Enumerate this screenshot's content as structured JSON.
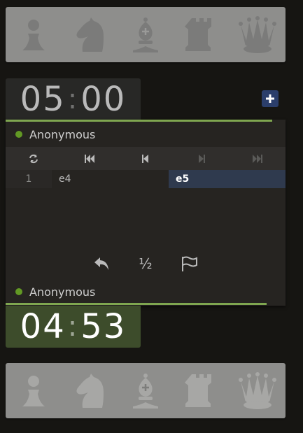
{
  "clocks": {
    "opponent": {
      "minutes": "05",
      "seconds": "00"
    },
    "player": {
      "minutes": "04",
      "seconds": "53"
    }
  },
  "players": {
    "top": {
      "name": "Anonymous"
    },
    "bottom": {
      "name": "Anonymous"
    }
  },
  "moves": [
    {
      "number": "1",
      "white": "e4",
      "black": "e5"
    }
  ],
  "actions": {
    "draw_label": "½"
  },
  "colors": {
    "accent_green": "#7fa650",
    "online_dot": "#629924",
    "active_move_bg": "#2f3a4e",
    "add_time_bg": "#2b3e6b"
  },
  "icons": {
    "pocket_pieces": [
      "pawn-icon",
      "knight-icon",
      "bishop-icon",
      "rook-icon",
      "queen-icon"
    ],
    "controls": [
      "flip-board-icon",
      "first-move-icon",
      "previous-move-icon",
      "next-move-icon",
      "last-move-icon"
    ],
    "actions": [
      "takeback-icon",
      "draw-offer",
      "resign-flag-icon"
    ],
    "add_time": "plus-icon"
  }
}
